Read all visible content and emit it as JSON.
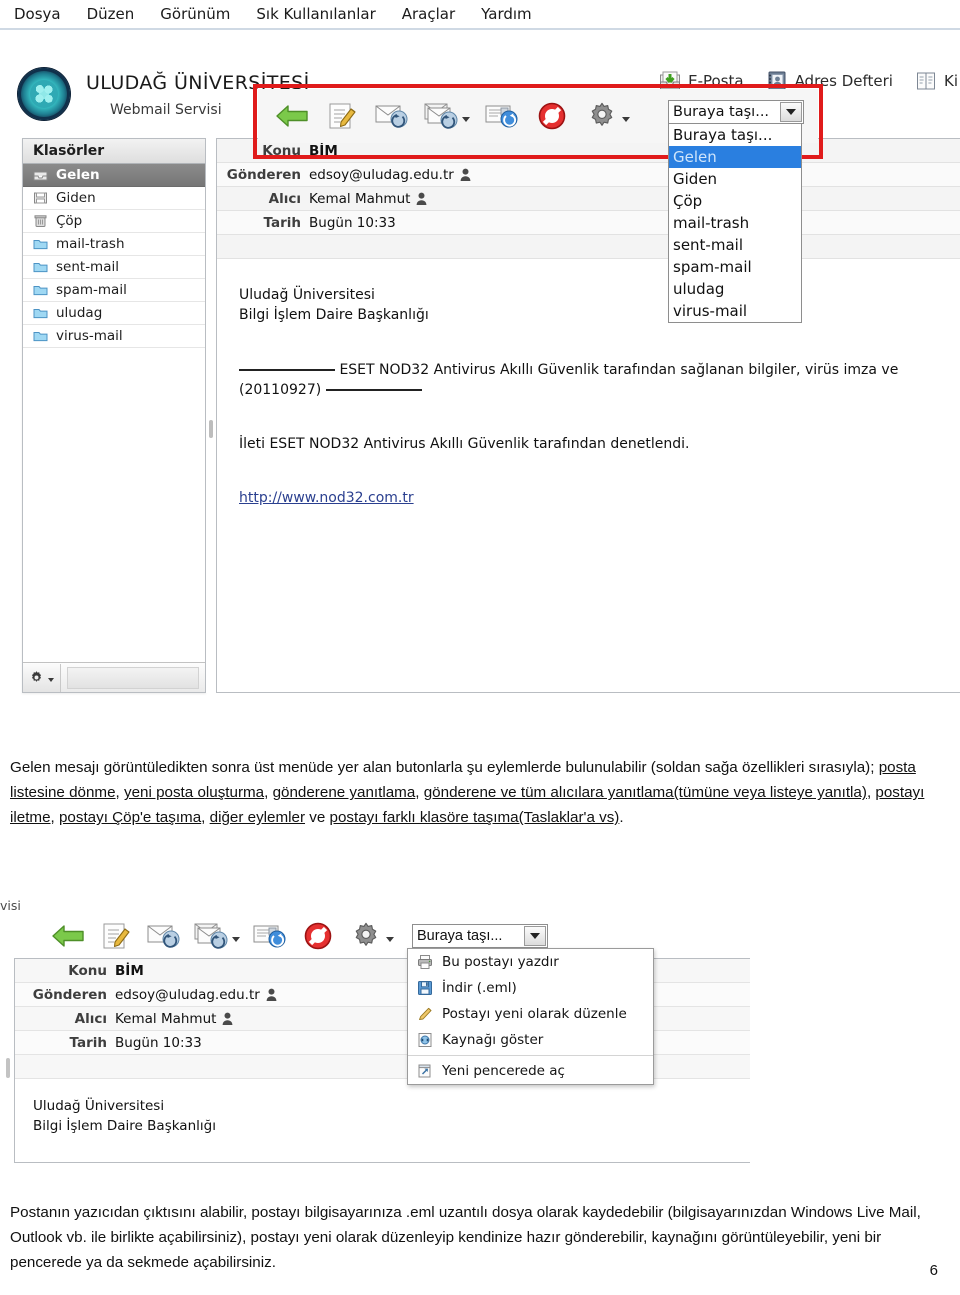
{
  "menubar": {
    "items": [
      {
        "label": "Dosya"
      },
      {
        "label": "Düzen"
      },
      {
        "label": "Görünüm"
      },
      {
        "label": "Sık Kullanılanlar"
      },
      {
        "label": "Araçlar"
      },
      {
        "label": "Yardım"
      }
    ]
  },
  "brand": {
    "title": "ULUDAĞ ÜNİVERSİTESİ",
    "subtitle": "Webmail Servisi",
    "logo_icon": "university-seal-icon"
  },
  "topnav": {
    "items": [
      {
        "label": "E-Posta",
        "icon": "inbox-download-icon"
      },
      {
        "label": "Adres Defteri",
        "icon": "address-book-icon"
      },
      {
        "label": "Ki",
        "icon": "personal-notes-icon"
      }
    ]
  },
  "folders": {
    "header": "Klasörler",
    "items": [
      {
        "label": "Gelen",
        "icon": "inbox-icon",
        "selected": true
      },
      {
        "label": "Giden",
        "icon": "outbox-icon",
        "selected": false
      },
      {
        "label": "Çöp",
        "icon": "trash-icon",
        "selected": false
      },
      {
        "label": "mail-trash",
        "icon": "folder-icon",
        "selected": false
      },
      {
        "label": "sent-mail",
        "icon": "folder-icon",
        "selected": false
      },
      {
        "label": "spam-mail",
        "icon": "folder-icon",
        "selected": false
      },
      {
        "label": "uludag",
        "icon": "folder-icon",
        "selected": false
      },
      {
        "label": "virus-mail",
        "icon": "folder-icon",
        "selected": false
      }
    ],
    "footer_icon": "gear-icon"
  },
  "toolbar": {
    "buttons": [
      {
        "name": "back-button",
        "icon": "green-left-arrow-icon"
      },
      {
        "name": "compose-button",
        "icon": "compose-pencil-icon"
      },
      {
        "name": "reply-button",
        "icon": "reply-envelope-icon"
      },
      {
        "name": "reply-all-button",
        "icon": "reply-all-envelope-icon",
        "has_caret": true
      },
      {
        "name": "forward-button",
        "icon": "forward-envelope-icon"
      },
      {
        "name": "delete-button",
        "icon": "red-block-icon"
      },
      {
        "name": "more-actions-button",
        "icon": "gear-icon",
        "has_caret": true
      }
    ]
  },
  "moveto": {
    "value": "Buraya taşı...",
    "caret_icon": "chevron-down-icon",
    "options": [
      {
        "label": "Buraya taşı...",
        "selected": false
      },
      {
        "label": "Gelen",
        "selected": true
      },
      {
        "label": "Giden",
        "selected": false
      },
      {
        "label": "Çöp",
        "selected": false
      },
      {
        "label": "mail-trash",
        "selected": false
      },
      {
        "label": "sent-mail",
        "selected": false
      },
      {
        "label": "spam-mail",
        "selected": false
      },
      {
        "label": "uludag",
        "selected": false
      },
      {
        "label": "virus-mail",
        "selected": false
      }
    ]
  },
  "message": {
    "headers": [
      {
        "label": "Konu",
        "value": "BİM",
        "bold": true,
        "person": false
      },
      {
        "label": "Gönderen",
        "value": "edsoy@uludag.edu.tr",
        "bold": false,
        "person": true
      },
      {
        "label": "Alıcı",
        "value": "Kemal Mahmut",
        "bold": false,
        "person": true
      },
      {
        "label": "Tarih",
        "value": "Bugün 10:33",
        "bold": false,
        "person": false
      }
    ],
    "signature_line1": "Uludağ Üniversitesi",
    "signature_line2": "Bilgi İşlem Daire Başkanlığı",
    "eset_prefix": "ESET NOD32 Antivirus Akıllı Güvenlik tarafından sağlanan bilgiler, virüs imza ve",
    "eset_version": "(20110927)",
    "eset_checked": "İleti ESET NOD32 Antivirus Akıllı Güvenlik tarafından denetlendi.",
    "eset_link": "http://www.nod32.com.tr"
  },
  "shot2": {
    "crumb": "visi",
    "context_menu": {
      "items": [
        {
          "label": "Bu postayı yazdır",
          "icon": "printer-icon",
          "separator_after": false
        },
        {
          "label": "İndir (.eml)",
          "icon": "save-disk-icon",
          "separator_after": false
        },
        {
          "label": "Postayı yeni olarak düzenle",
          "icon": "pencil-icon",
          "separator_after": false
        },
        {
          "label": "Kaynağı göster",
          "icon": "source-code-icon",
          "separator_after": true
        },
        {
          "label": "Yeni pencerede aç",
          "icon": "new-window-icon",
          "separator_after": false
        }
      ]
    }
  },
  "paragraphs": {
    "p1_part1": "Gelen mesajı görüntüledikten sonra üst menüde yer alan butonlarla şu eylemlerde bulunulabilir (soldan sağa özellikleri sırasıyla); ",
    "p1_u1": "posta listesine dönme",
    "p1_sep1": ", ",
    "p1_u2": "yeni posta oluşturma",
    "p1_sep2": ", ",
    "p1_u3": "gönderene yanıtlama",
    "p1_sep3": ", ",
    "p1_u4": "gönderene ve tüm alıcılara yanıtlama(tümüne veya listeye yanıtla)",
    "p1_sep4": ", ",
    "p1_u5": "postayı iletme",
    "p1_sep5": ", ",
    "p1_u6": "postayı Çöp'e taşıma",
    "p1_sep6": ", ",
    "p1_u7": "diğer eylemler",
    "p1_sep7": " ve ",
    "p1_u8": "postayı farklı klasöre taşıma(Taslaklar'a vs)",
    "p1_end": ".",
    "p2": "Postanın yazıcıdan çıktısını alabilir, postayı bilgisayarınıza .eml uzantılı dosya olarak kaydedebilir (bilgisayarınızdan Windows Live Mail, Outlook vb. ile birlikte açabilirsiniz), postayı yeni olarak düzenleyip kendinize hazır gönderebilir, kaynağını görüntüleyebilir, yeni bir pencerede ya da sekmede açabilirsiniz."
  },
  "page_number": "6",
  "colors": {
    "highlight_red": "#e01b1b",
    "selection_blue": "#2a7fe0",
    "brand_teal": "#2fa9b4",
    "link_blue": "#2a3f8f"
  }
}
